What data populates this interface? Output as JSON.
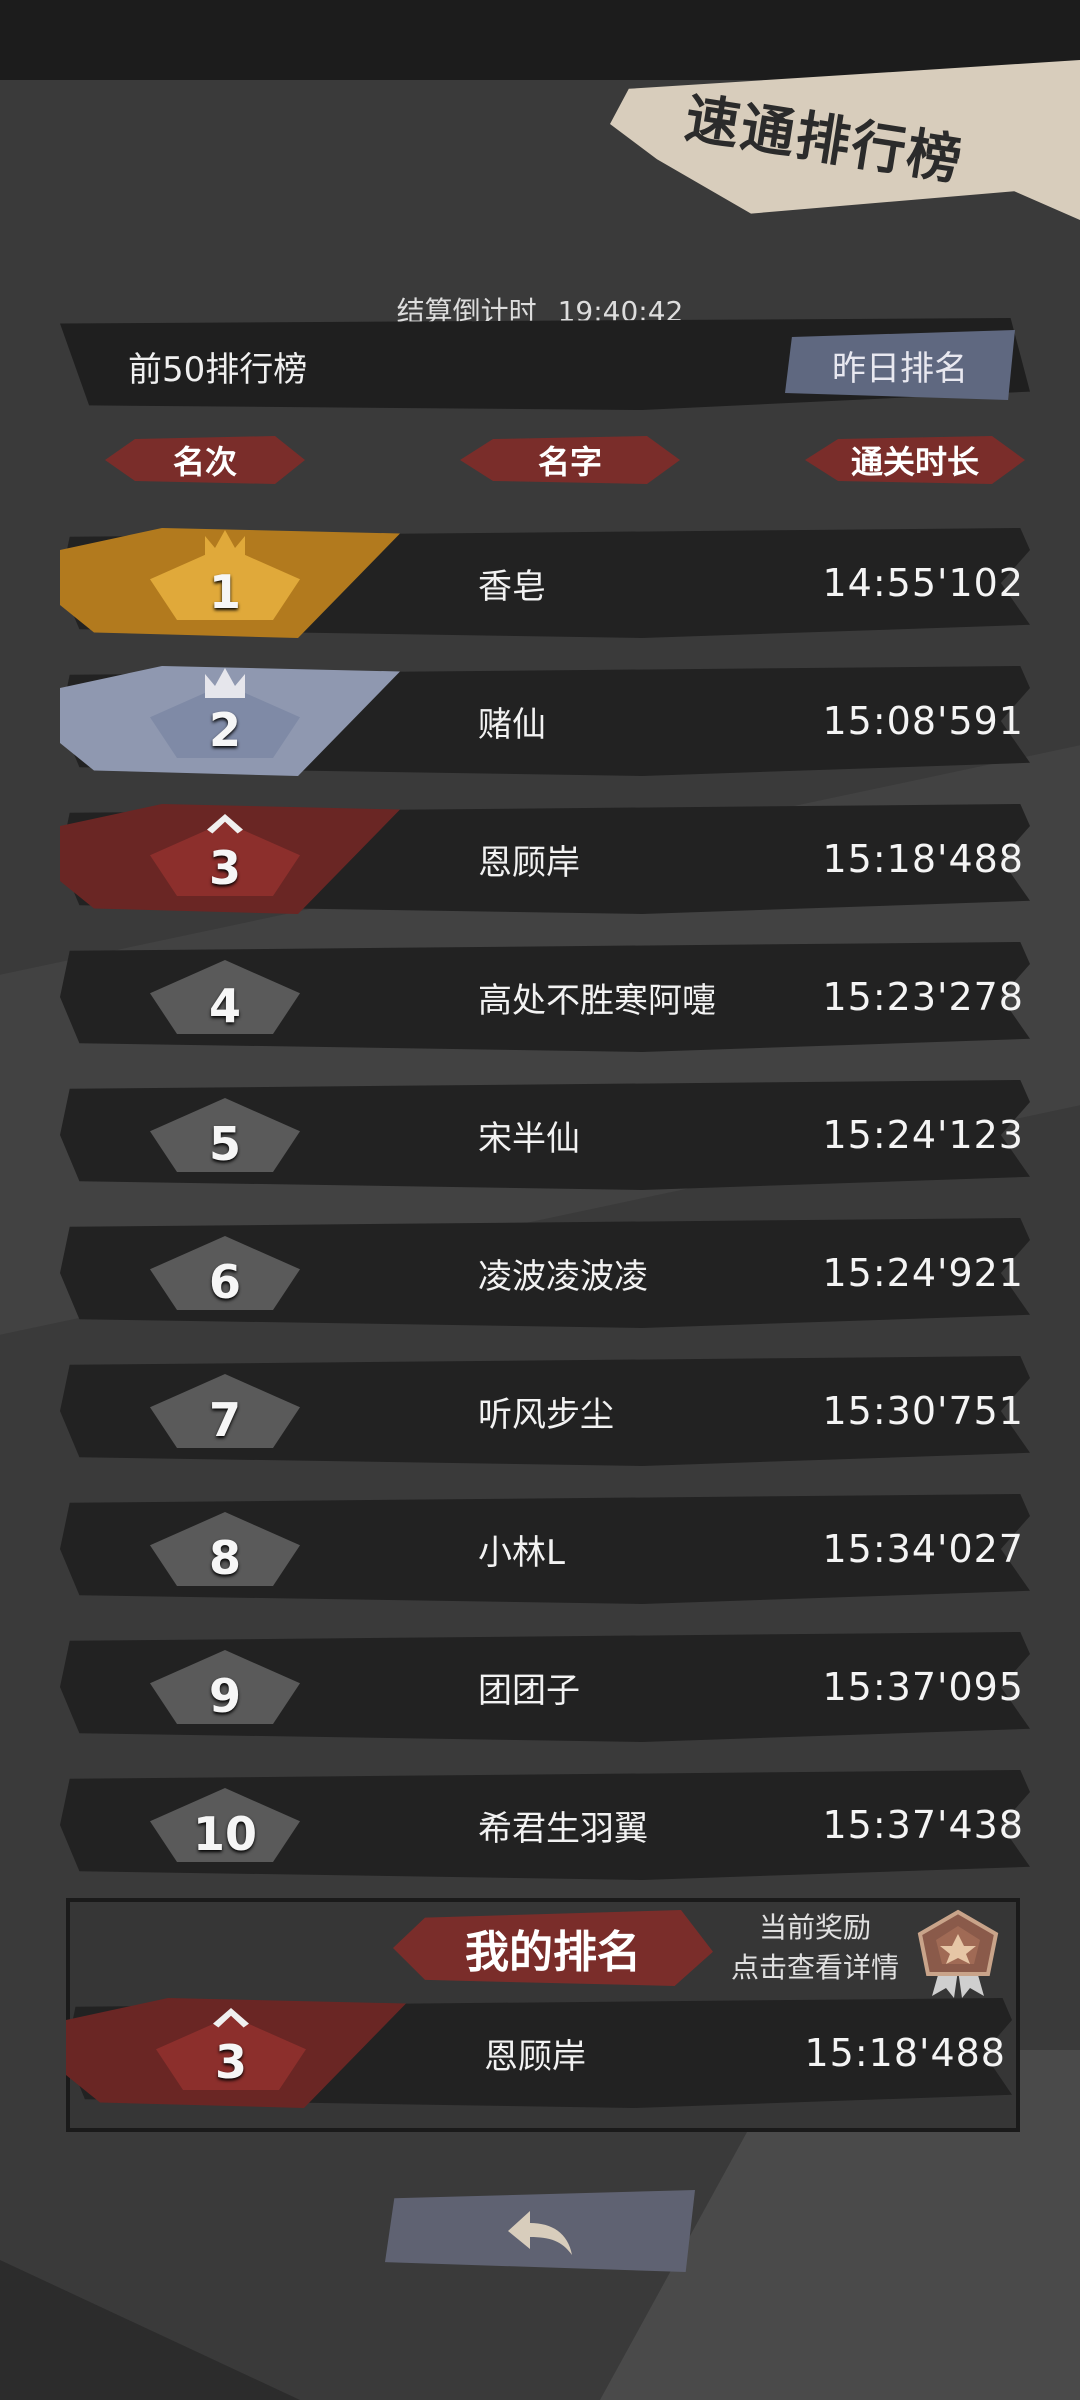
{
  "screen": {
    "title": "速通排行榜"
  },
  "countdown": {
    "label": "结算倒计时",
    "time": "19:40:42"
  },
  "board": {
    "scope_label": "前50排行榜",
    "yesterday_button": "昨日排名"
  },
  "table": {
    "headers": {
      "rank": "名次",
      "name": "名字",
      "time": "通关时长"
    },
    "rows": [
      {
        "rank": "1",
        "name": "香皂",
        "time": "14:55'102",
        "badge": "gold-crown"
      },
      {
        "rank": "2",
        "name": "赌仙",
        "time": "15:08'591",
        "badge": "silver-crown"
      },
      {
        "rank": "3",
        "name": "恩顾岸",
        "time": "15:18'488",
        "badge": "bronze-chevron"
      },
      {
        "rank": "4",
        "name": "高处不胜寒阿嚏",
        "time": "15:23'278",
        "badge": "grey"
      },
      {
        "rank": "5",
        "name": "宋半仙",
        "time": "15:24'123",
        "badge": "grey"
      },
      {
        "rank": "6",
        "name": "凌波凌波凌",
        "time": "15:24'921",
        "badge": "grey"
      },
      {
        "rank": "7",
        "name": "听风步尘",
        "time": "15:30'751",
        "badge": "grey"
      },
      {
        "rank": "8",
        "name": "小林L",
        "time": "15:34'027",
        "badge": "grey"
      },
      {
        "rank": "9",
        "name": "团团子",
        "time": "15:37'095",
        "badge": "grey"
      },
      {
        "rank": "10",
        "name": "希君生羽翼",
        "time": "15:37'438",
        "badge": "grey"
      }
    ]
  },
  "my_rank": {
    "title": "我的排名",
    "reward_line1": "当前奖励",
    "reward_line2": "点击查看详情",
    "rank": "3",
    "name": "恩顾岸",
    "time": "15:18'488",
    "badge": "bronze-chevron"
  },
  "icons": {
    "back": "back-arrow-icon",
    "medal": "reward-medal-icon"
  },
  "colors": {
    "gold": "#e0a93a",
    "silver": "#7f8aa6",
    "bronze": "#8c2f2c",
    "grey_badge": "#5a5a5a",
    "header_red": "#7a2d2a",
    "banner": "#d8cdbc"
  }
}
